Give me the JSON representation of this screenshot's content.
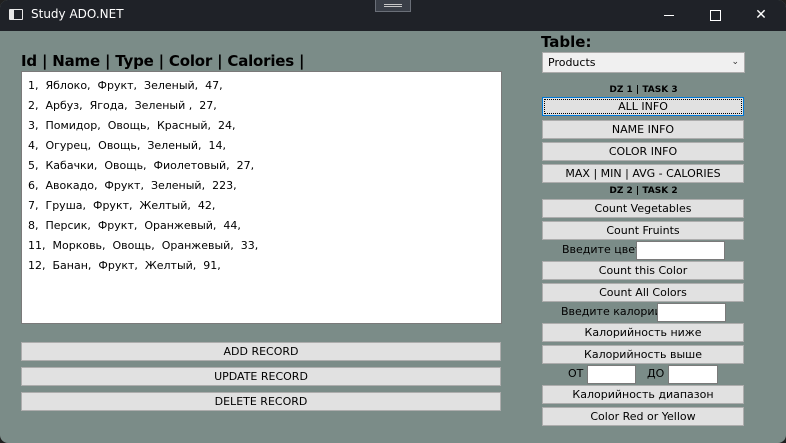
{
  "window": {
    "title": "Study ADO.NET",
    "icons": [
      "app-icon",
      "minimize-icon",
      "maximize-icon",
      "close-icon"
    ]
  },
  "list": {
    "header": "Id | Name | Type | Color | Calories |",
    "rows": [
      "1,  Яблоко,  Фрукт,  Зеленый,  47,",
      "2,  Арбуз,  Ягода,  Зеленый ,  27,",
      "3,  Помидор,  Овощь,  Красный,  24,",
      "4,  Огурец,  Овощь,  Зеленый,  14,",
      "5,  Кабачки,  Овощь,  Фиолетовый,  27,",
      "6,  Авокадо,  Фрукт,  Зеленый,  223,",
      "7,  Груша,  Фрукт,  Желтый,  42,",
      "8,  Персик,  Фрукт,  Оранжевый,  44,",
      "11,  Морковь,  Овощь,  Оранжевый,  33,",
      "12,  Банан,  Фрукт,  Желтый,  91,"
    ]
  },
  "record_buttons": {
    "add": "ADD RECORD",
    "update": "UPDATE RECORD",
    "delete": "DELETE RECORD"
  },
  "table_select": {
    "label": "Table:",
    "value": "Products"
  },
  "dz1": {
    "label": "DZ 1 | TASK 3",
    "all_info": "ALL INFO",
    "name_info": "NAME INFO",
    "color_info": "COLOR INFO",
    "calories_stats": "MAX | MIN | AVG - CALORIES"
  },
  "dz2": {
    "label": "DZ 2 | TASK 2",
    "count_vegetables": "Count Vegetables",
    "count_fruits": "Count Fruints",
    "color_label": "Введите цвет",
    "color_value": "",
    "count_this_color": "Count this Color",
    "count_all_colors": "Count All Colors",
    "calories_label": "Введите калории",
    "calories_value": "",
    "calories_lower": "Калорийность ниже",
    "calories_higher": "Калорийность выше",
    "from_label": "ОТ",
    "from_value": "",
    "to_label": "ДО",
    "to_value": "",
    "calories_range": "Калорийность диапазон",
    "color_red_yellow": "Color Red or Yellow"
  }
}
